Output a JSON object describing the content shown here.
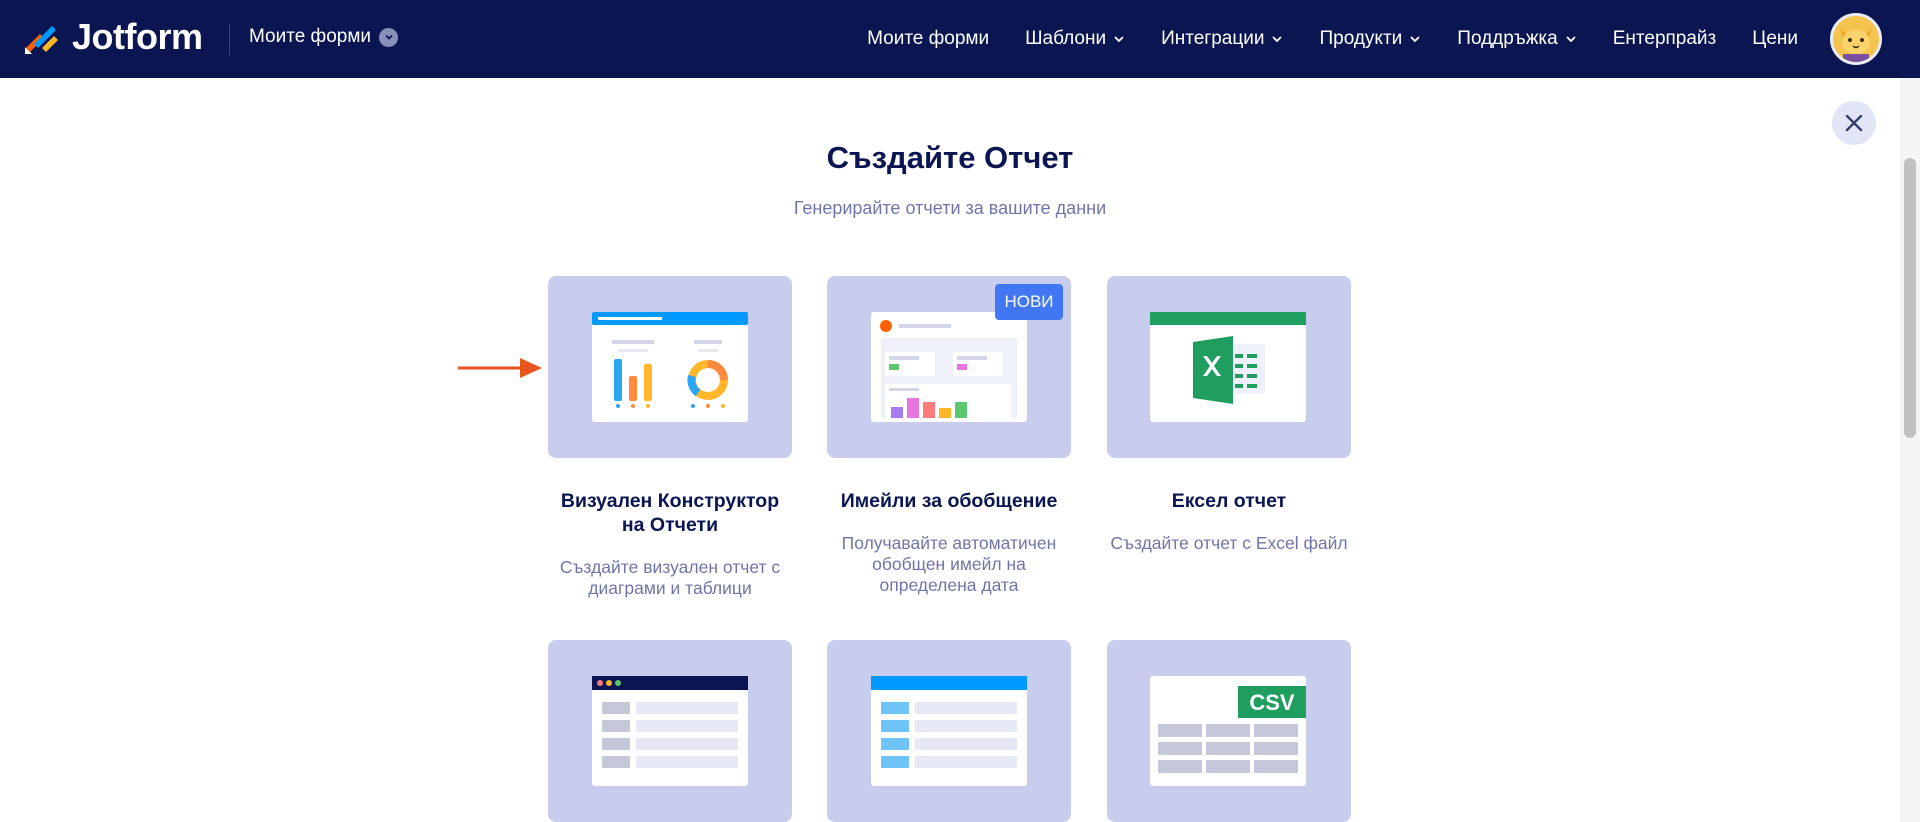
{
  "header": {
    "brand": "Jotform",
    "my_forms_dropdown": "Моите форми",
    "nav": [
      {
        "label": "Моите форми",
        "has_dropdown": false
      },
      {
        "label": "Шаблони",
        "has_dropdown": true
      },
      {
        "label": "Интеграции",
        "has_dropdown": true
      },
      {
        "label": "Продукти",
        "has_dropdown": true
      },
      {
        "label": "Поддръжка",
        "has_dropdown": true
      },
      {
        "label": "Ентерпрайз",
        "has_dropdown": false
      },
      {
        "label": "Цени",
        "has_dropdown": false
      }
    ],
    "avatar_icon": "user-avatar-icon"
  },
  "page": {
    "title": "Създайте Отчет",
    "subtitle": "Генерирайте отчети за вашите данни"
  },
  "cards": [
    {
      "title_line1": "Визуален Конструктор",
      "title_line2": "на Отчети",
      "desc_line1": "Създайте визуален отчет с",
      "desc_line2": "диаграми и таблици",
      "icon": "visual-report-icon"
    },
    {
      "title_line1": "Имейли за обобщение",
      "badge": "НОВИ",
      "desc_line1": "Получавайте автоматичен",
      "desc_line2": "обобщен имейл на",
      "desc_line3": "определена дата",
      "icon": "digest-email-icon"
    },
    {
      "title_line1": "Ексел отчет",
      "desc_line1": "Създайте отчет с Excel файл",
      "icon": "excel-report-icon"
    },
    {
      "icon": "html-table-icon"
    },
    {
      "icon": "grid-listing-icon"
    },
    {
      "icon": "csv-report-icon",
      "csv_label": "CSV"
    }
  ],
  "colors": {
    "nav_bg": "#0a1551",
    "card_bg": "#c8cdee",
    "badge_bg": "#4277f3",
    "excel_green": "#1f9e5f",
    "arrow": "#e8551c"
  }
}
